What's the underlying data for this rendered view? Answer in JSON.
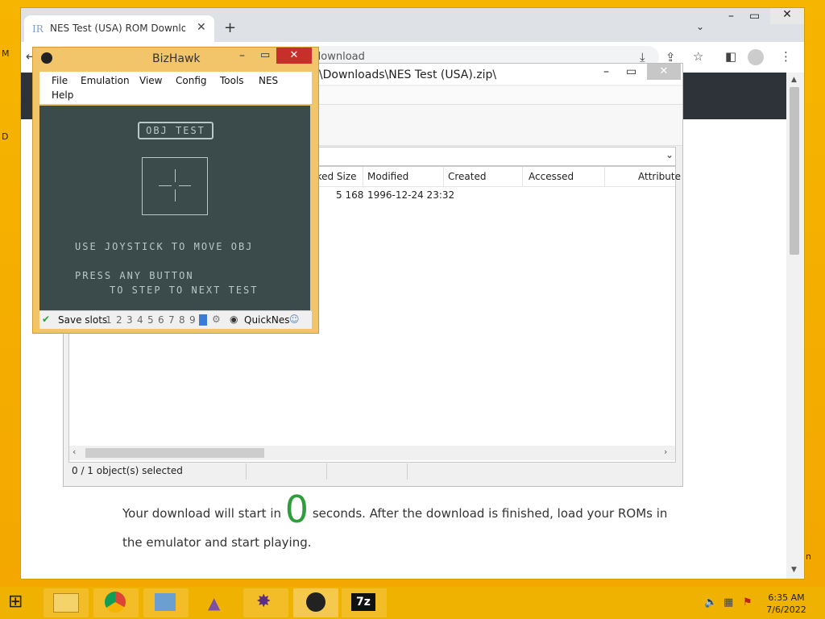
{
  "desktop": {
    "letters": [
      "M",
      "D",
      "n"
    ]
  },
  "browser": {
    "tab_title": "NES Test (USA) ROM Download",
    "tab_favicon": "IR",
    "address_fragment": "download",
    "page_countdown": "0",
    "page_text_before": "Your download will start in",
    "page_text_after": "seconds. After the download is finished, load your ROMs in the emulator and start playing."
  },
  "sevenzip": {
    "title": "4\\Downloads\\NES Test (USA).zip\\",
    "columns": [
      "cked Size",
      "Modified",
      "Created",
      "Accessed",
      "Attribute"
    ],
    "row": {
      "packed": "5 168",
      "modified": "1996-12-24 23:32"
    },
    "status": "0 / 1 object(s) selected"
  },
  "bizhawk": {
    "title": "BizHawk",
    "menu": [
      "File",
      "Emulation",
      "View",
      "Config",
      "Tools",
      "NES",
      "Help"
    ],
    "screen": {
      "obj_label": "OBJ TEST",
      "line1": "USE JOYSTICK TO MOVE OBJ",
      "line2": "PRESS ANY BUTTON",
      "line3": "TO STEP TO NEXT TEST"
    },
    "status": {
      "save_slots": "Save slots",
      "slots": [
        "1",
        "2",
        "3",
        "4",
        "5",
        "6",
        "7",
        "8",
        "9"
      ],
      "core": "QuickNes"
    }
  },
  "taskbar": {
    "time": "6:35 AM",
    "date": "7/6/2022"
  },
  "colors": {
    "accent_green": "#2e9d3b",
    "bizhawk_frame": "#f3c56a",
    "nes_bg": "#3b4b4b"
  }
}
